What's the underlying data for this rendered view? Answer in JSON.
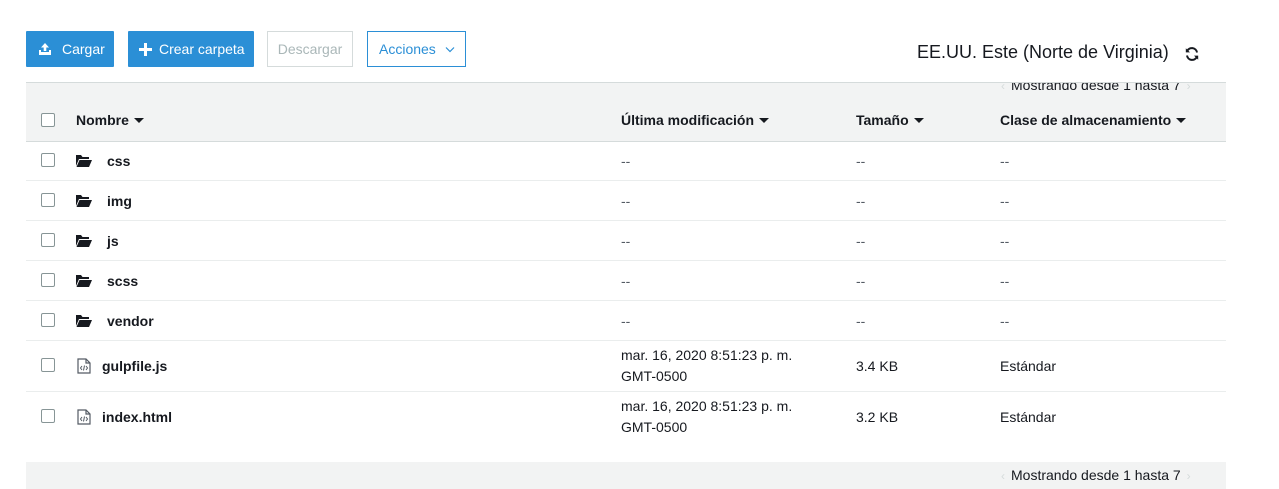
{
  "toolbar": {
    "upload_label": "Cargar",
    "create_folder_label": "Crear carpeta",
    "download_label": "Descargar",
    "actions_label": "Acciones",
    "region": "EE.UU. Este (Norte de Virginia)"
  },
  "pager": {
    "top_text": "Mostrando desde 1 hasta 7",
    "bottom_text": "Mostrando desde 1 hasta 7"
  },
  "table": {
    "columns": [
      "Nombre",
      "Última modificación",
      "Tamaño",
      "Clase de almacenamiento"
    ],
    "rows": [
      {
        "type": "folder",
        "name": "css",
        "modified_1": "--",
        "modified_2": "",
        "size": "--",
        "storage": "--"
      },
      {
        "type": "folder",
        "name": "img",
        "modified_1": "--",
        "modified_2": "",
        "size": "--",
        "storage": "--"
      },
      {
        "type": "folder",
        "name": "js",
        "modified_1": "--",
        "modified_2": "",
        "size": "--",
        "storage": "--"
      },
      {
        "type": "folder",
        "name": "scss",
        "modified_1": "--",
        "modified_2": "",
        "size": "--",
        "storage": "--"
      },
      {
        "type": "folder",
        "name": "vendor",
        "modified_1": "--",
        "modified_2": "",
        "size": "--",
        "storage": "--"
      },
      {
        "type": "file",
        "name": "gulpfile.js",
        "modified_1": "mar. 16, 2020 8:51:23 p. m.",
        "modified_2": "GMT-0500",
        "size": "3.4 KB",
        "storage": "Estándar"
      },
      {
        "type": "file",
        "name": "index.html",
        "modified_1": "mar. 16, 2020 8:51:23 p. m.",
        "modified_2": "GMT-0500",
        "size": "3.2 KB",
        "storage": "Estándar"
      }
    ]
  },
  "icons": {
    "upload": "upload-icon",
    "add": "plus-icon",
    "actions_chevron": "chevron-down-icon",
    "refresh": "refresh-icon",
    "folder": "folder-open-icon",
    "file": "code-file-icon",
    "sort": "caret-down-icon"
  },
  "colors": {
    "primary": "#2b8fd6",
    "header_bg": "#f2f3f3",
    "disabled_text": "#aab7b8",
    "border": "#d5dbdb"
  }
}
